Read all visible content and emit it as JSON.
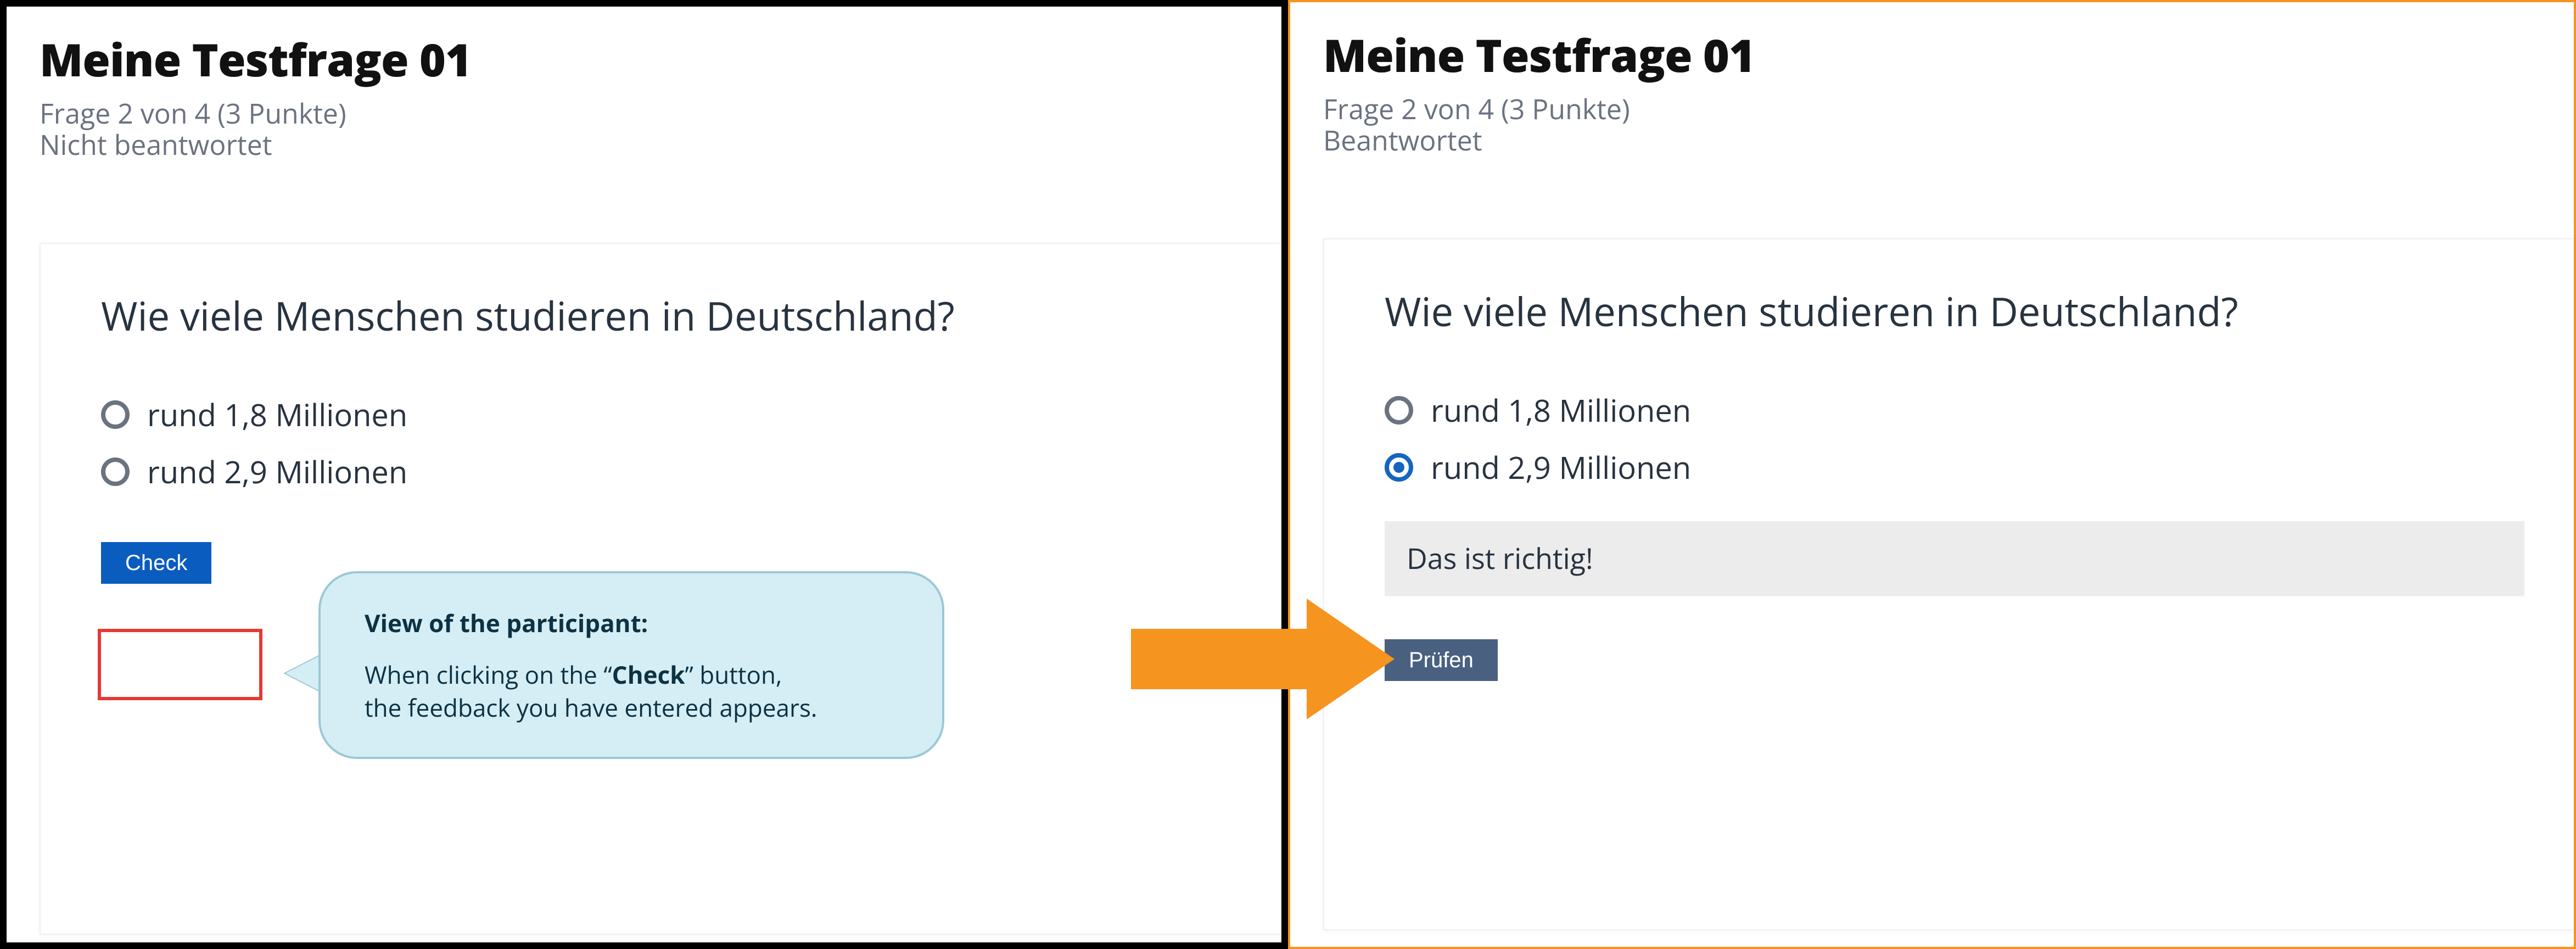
{
  "left": {
    "title": "Meine Testfrage 01",
    "progress": "Frage 2 von 4 (3 Punkte)",
    "status": "Nicht beantwortet",
    "question": "Wie viele Menschen studieren in Deutschland?",
    "options": [
      {
        "label": "rund 1,8 Millionen",
        "checked": false
      },
      {
        "label": "rund 2,9 Millionen",
        "checked": false
      }
    ],
    "button_label": "Check"
  },
  "callout": {
    "heading": "View of the participant:",
    "line1_pre": "When clicking on the “",
    "line1_bold": "Check",
    "line1_post": "” button,",
    "line2": "the feedback you have entered appears."
  },
  "right": {
    "title": "Meine Testfrage 01",
    "progress": "Frage 2 von 4 (3 Punkte)",
    "status": "Beantwortet",
    "question": "Wie viele Menschen studieren in Deutschland?",
    "options": [
      {
        "label": "rund 1,8 Millionen",
        "checked": false
      },
      {
        "label": "rund 2,9 Millionen",
        "checked": true
      }
    ],
    "feedback": "Das ist richtig!",
    "button_label": "Prüfen"
  },
  "colors": {
    "accent_blue": "#1565c0",
    "arrow_orange": "#f5941f",
    "highlight_red": "#e53935"
  }
}
